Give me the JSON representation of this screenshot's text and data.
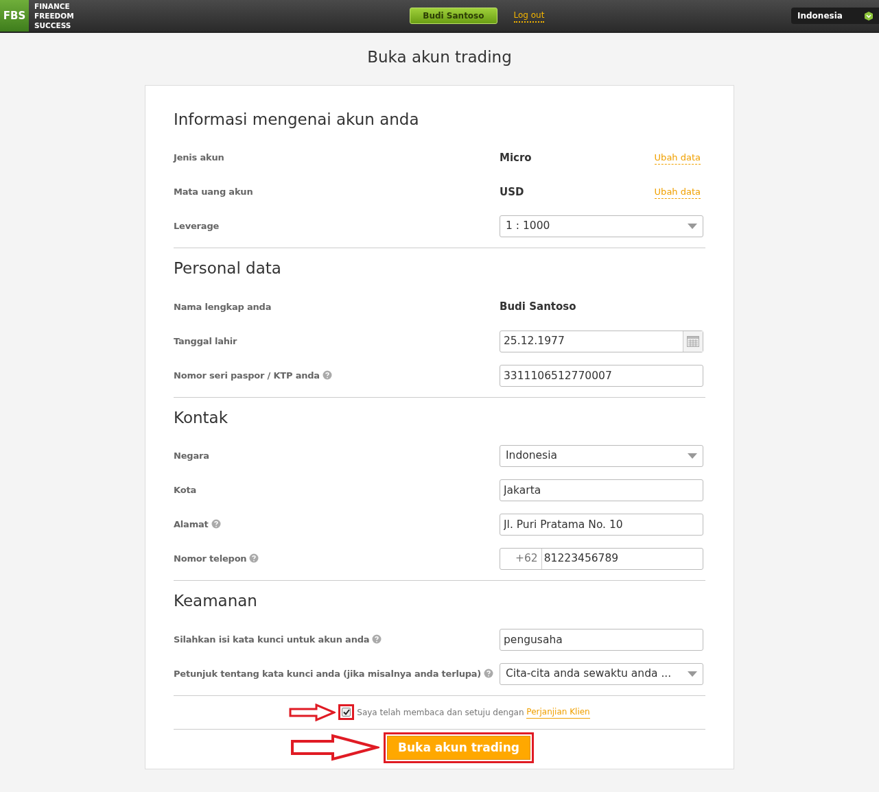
{
  "header": {
    "logo_mark": "FBS",
    "logo_lines": [
      "FINANCE",
      "FREEDOM",
      "SUCCESS"
    ],
    "user_button": "Budi Santoso",
    "logout_link": "Log out",
    "language": "Indonesia"
  },
  "page_title": "Buka akun trading",
  "sections": [
    {
      "title": "Informasi mengenai akun anda",
      "rows": [
        {
          "kind": "text",
          "label": "Jenis akun",
          "help": false,
          "value": "Micro",
          "link": "Ubah data"
        },
        {
          "kind": "text",
          "label": "Mata uang akun",
          "help": false,
          "value": "USD",
          "link": "Ubah data"
        },
        {
          "kind": "select",
          "label": "Leverage",
          "help": false,
          "value": "1 : 1000"
        }
      ]
    },
    {
      "title": "Personal data",
      "rows": [
        {
          "kind": "text",
          "label": "Nama lengkap anda",
          "help": false,
          "value": "Budi Santoso"
        },
        {
          "kind": "date",
          "label": "Tanggal lahir",
          "help": false,
          "value": "25.12.1977"
        },
        {
          "kind": "input",
          "label": "Nomor seri paspor / KTP anda",
          "help": true,
          "value": "3311106512770007"
        }
      ]
    },
    {
      "title": "Kontak",
      "rows": [
        {
          "kind": "select",
          "label": "Negara",
          "help": false,
          "value": "Indonesia"
        },
        {
          "kind": "input",
          "label": "Kota",
          "help": false,
          "value": "Jakarta"
        },
        {
          "kind": "input",
          "label": "Alamat",
          "help": true,
          "value": "Jl. Puri Pratama No. 10"
        },
        {
          "kind": "phone",
          "label": "Nomor telepon",
          "help": true,
          "prefix": "+62",
          "value": "81223456789"
        }
      ]
    },
    {
      "title": "Keamanan",
      "rows": [
        {
          "kind": "input",
          "label": "Silahkan isi kata kunci untuk akun anda",
          "help": true,
          "value": "pengusaha"
        },
        {
          "kind": "select",
          "label": "Petunjuk tentang kata kunci anda (jika misalnya anda terlupa)",
          "help": true,
          "value": "Cita-cita anda sewaktu anda ..."
        }
      ]
    }
  ],
  "agreement": {
    "checked": true,
    "text": "Saya telah membaca dan setuju dengan",
    "link": "Perjanjian Klien"
  },
  "submit_button": "Buka akun trading"
}
